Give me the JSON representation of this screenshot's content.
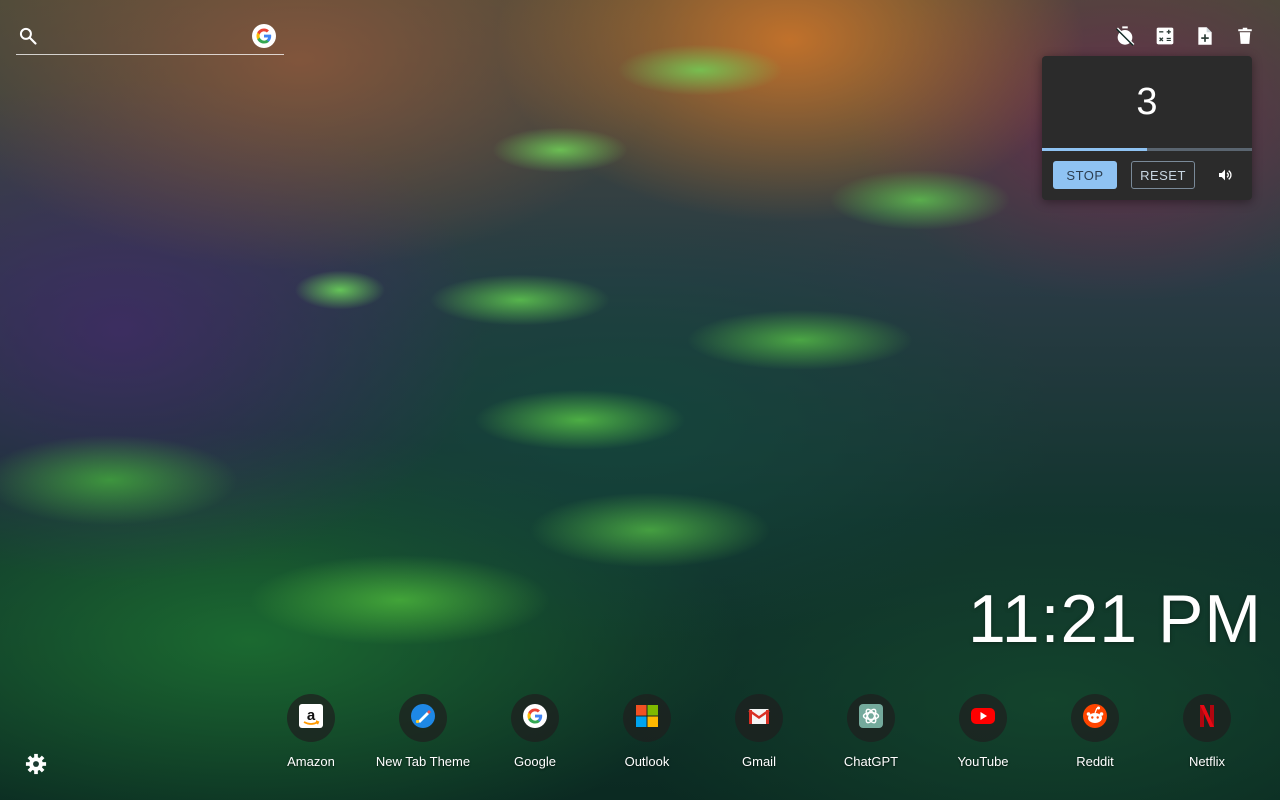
{
  "search": {
    "value": "",
    "placeholder": "",
    "engine_icon": "google-icon"
  },
  "toolbar": {
    "items": [
      "timer-off-icon",
      "calculator-icon",
      "note-add-icon",
      "delete-icon"
    ]
  },
  "timer": {
    "value": "3",
    "progress": 0.5,
    "stop_label": "STOP",
    "reset_label": "RESET",
    "volume_icon": "volume-icon",
    "accent_color": "#8fc3f3"
  },
  "clock": {
    "time": "11:21 PM"
  },
  "shortcuts": [
    {
      "label": "Amazon",
      "icon": "amazon-icon"
    },
    {
      "label": "New Tab Theme",
      "icon": "new-tab-theme-icon"
    },
    {
      "label": "Google",
      "icon": "google-icon"
    },
    {
      "label": "Outlook",
      "icon": "microsoft-icon"
    },
    {
      "label": "Gmail",
      "icon": "gmail-icon"
    },
    {
      "label": "ChatGPT",
      "icon": "chatgpt-icon"
    },
    {
      "label": "YouTube",
      "icon": "youtube-icon"
    },
    {
      "label": "Reddit",
      "icon": "reddit-icon"
    },
    {
      "label": "Netflix",
      "icon": "netflix-icon"
    }
  ],
  "settings": {
    "icon": "gear-icon"
  }
}
